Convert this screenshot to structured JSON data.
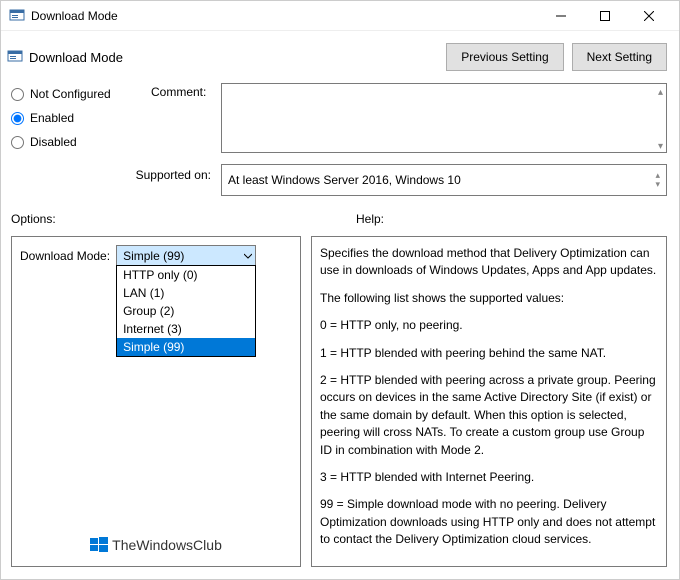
{
  "window": {
    "title": "Download Mode"
  },
  "header": {
    "page_title": "Download Mode",
    "prev_btn": "Previous Setting",
    "next_btn": "Next Setting"
  },
  "state": {
    "not_configured": "Not Configured",
    "enabled": "Enabled",
    "disabled": "Disabled",
    "selected": "enabled"
  },
  "comment": {
    "label": "Comment:",
    "value": ""
  },
  "supported": {
    "label": "Supported on:",
    "value": "At least Windows Server 2016, Windows 10"
  },
  "sections": {
    "options": "Options:",
    "help": "Help:"
  },
  "download_mode": {
    "label": "Download Mode:",
    "selected": "Simple (99)",
    "options": [
      {
        "label": "HTTP only (0)",
        "selected": false
      },
      {
        "label": "LAN (1)",
        "selected": false
      },
      {
        "label": "Group (2)",
        "selected": false
      },
      {
        "label": "Internet (3)",
        "selected": false
      },
      {
        "label": "Simple (99)",
        "selected": true
      }
    ]
  },
  "help_text": {
    "p1": "Specifies the download method that Delivery Optimization can use in downloads of Windows Updates, Apps and App updates.",
    "p2": "The following list shows the supported values:",
    "p3": "0 = HTTP only, no peering.",
    "p4": "1 = HTTP blended with peering behind the same NAT.",
    "p5": "2 = HTTP blended with peering across a private group. Peering occurs on devices in the same Active Directory Site (if exist) or the same domain by default. When this option is selected, peering will cross NATs. To create a custom group use Group ID in combination with Mode 2.",
    "p6": "3 = HTTP blended with Internet Peering.",
    "p7": "99 = Simple download mode with no peering. Delivery Optimization downloads using HTTP only and does not attempt to contact the Delivery Optimization cloud services."
  },
  "branding": {
    "text": "TheWindowsClub"
  }
}
